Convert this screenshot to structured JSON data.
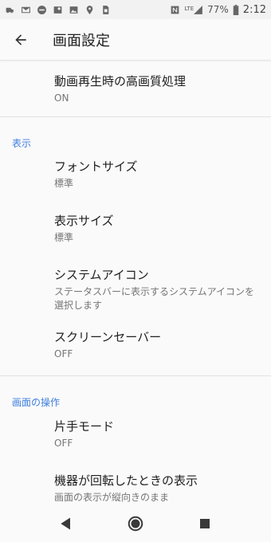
{
  "status_bar": {
    "left_icons": [
      "car-icon",
      "gmail-icon",
      "do-not-disturb-icon",
      "map-icon",
      "image-icon",
      "location-icon",
      "sim-icon"
    ],
    "right_icons": [
      "nfc-icon",
      "signal-icon",
      "battery-icon"
    ],
    "network": "LTE",
    "battery": "77%",
    "time": "2:12"
  },
  "app_bar": {
    "back_icon": "arrow-back-icon",
    "title": "画面設定"
  },
  "items": [
    {
      "title": "動画再生時の高画質処理",
      "subtitle": "ON"
    }
  ],
  "sections": [
    {
      "header": "表示",
      "items": [
        {
          "title": "フォントサイズ",
          "subtitle": "標準"
        },
        {
          "title": "表示サイズ",
          "subtitle": "標準"
        },
        {
          "title": "システムアイコン",
          "subtitle": "ステータスバーに表示するシステムアイコンを選択します"
        },
        {
          "title": "スクリーンセーバー",
          "subtitle": "OFF"
        }
      ]
    },
    {
      "header": "画面の操作",
      "items": [
        {
          "title": "片手モード",
          "subtitle": "OFF"
        },
        {
          "title": "機器が回転したときの表示",
          "subtitle": "画面の表示が縦向きのまま"
        }
      ]
    }
  ],
  "nav_bar": {
    "buttons": [
      "back-triangle-icon",
      "home-circle-icon",
      "recents-square-icon"
    ]
  },
  "colors": {
    "accent": "#3f7ee0",
    "text_primary": "#212121",
    "text_secondary": "#757575",
    "background": "#fafafa"
  }
}
